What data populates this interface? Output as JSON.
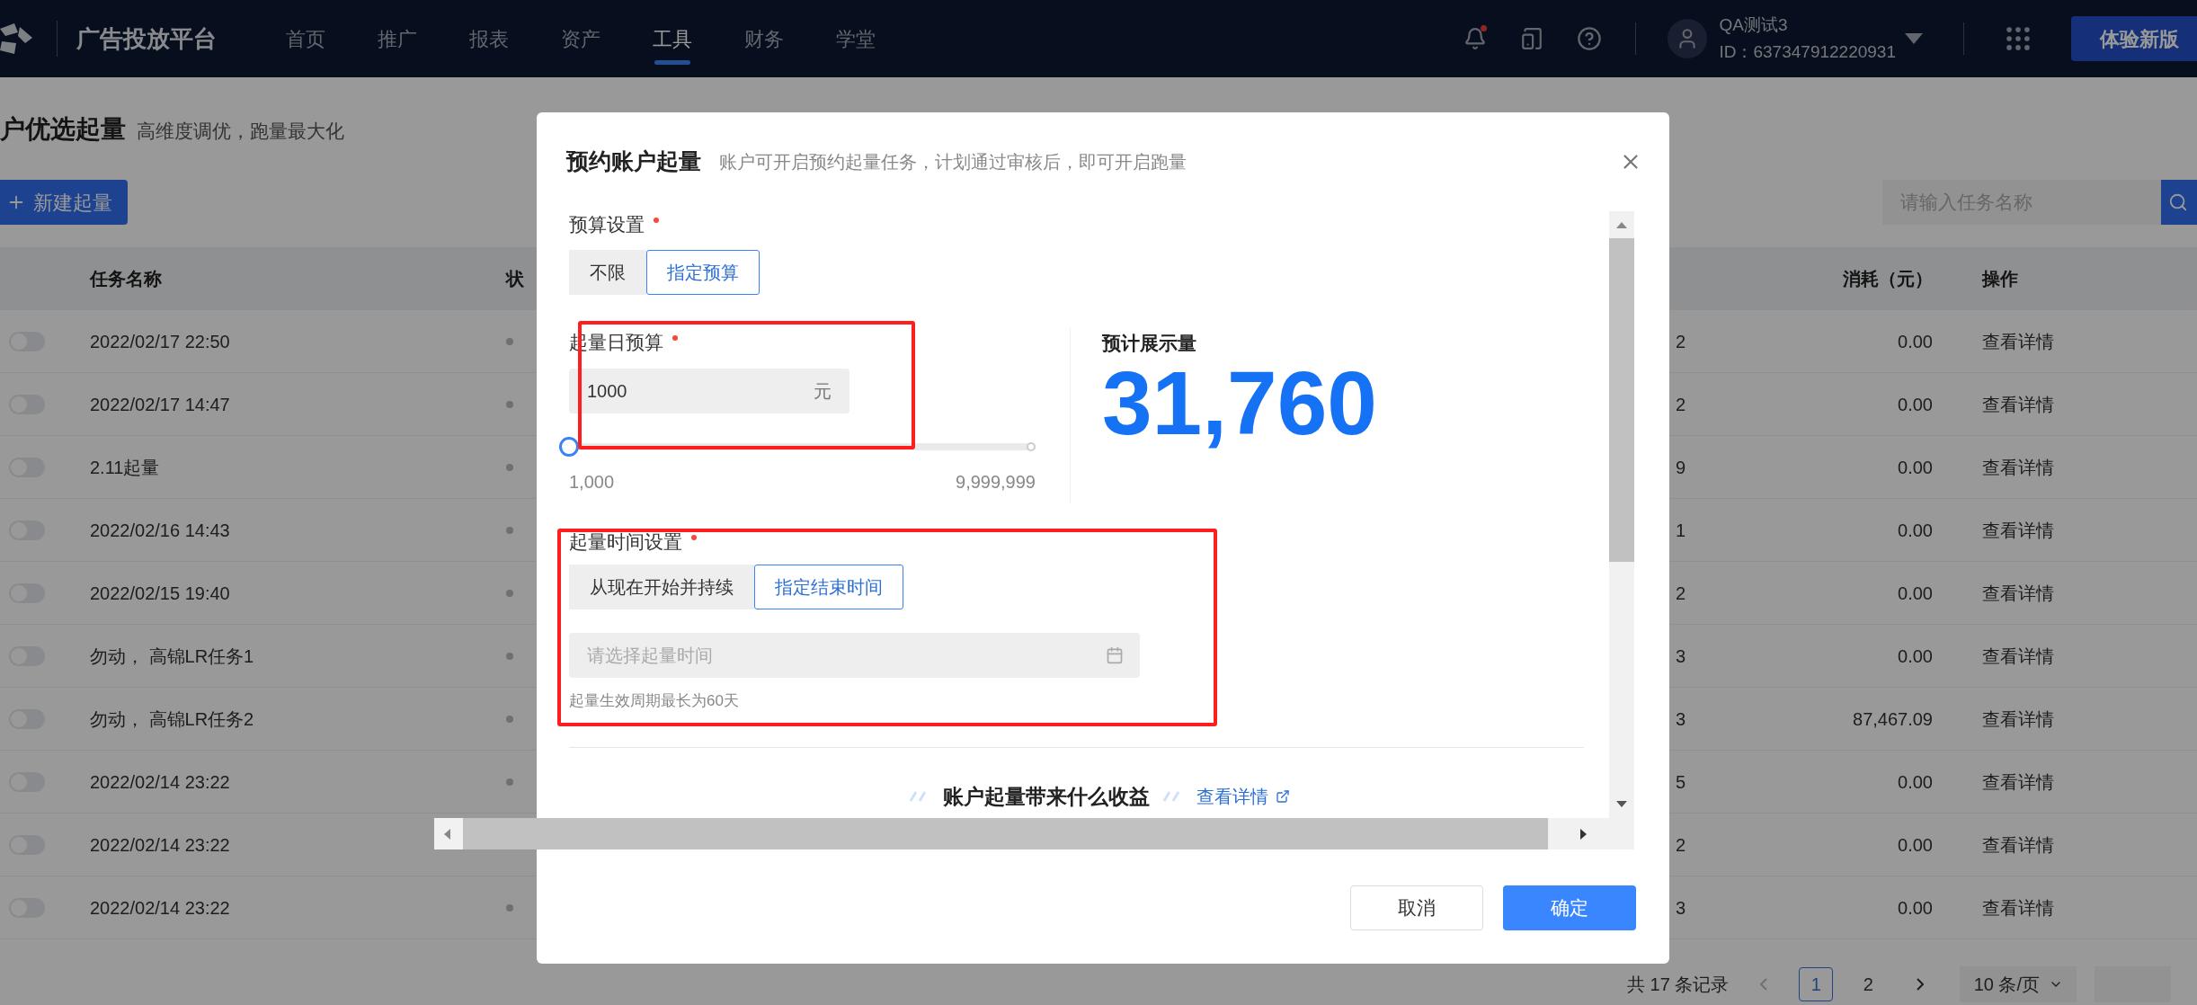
{
  "nav": {
    "brand": "广告投放平台",
    "menu": [
      {
        "label": "首页",
        "selected": false
      },
      {
        "label": "推广",
        "selected": false
      },
      {
        "label": "报表",
        "selected": false
      },
      {
        "label": "资产",
        "selected": false
      },
      {
        "label": "工具",
        "selected": true
      },
      {
        "label": "财务",
        "selected": false
      },
      {
        "label": "学堂",
        "selected": false
      }
    ],
    "unread": true,
    "user": {
      "name": "QA测试3",
      "id": "ID：637347912220931"
    },
    "cta": "体验新版"
  },
  "page": {
    "title": "户优选起量",
    "subtitle": "高维度调优，跑量最大化",
    "new_button": "新建起量",
    "search": {
      "placeholder": "请输入任务名称"
    }
  },
  "table": {
    "columns": {
      "name": "任务名称",
      "status": "状",
      "cost": "消耗（元）",
      "action": "操作"
    },
    "rows": [
      {
        "on": false,
        "name": "2022/02/17 22:50",
        "column_4": "2",
        "cost": "0.00",
        "action": "查看详情"
      },
      {
        "on": false,
        "name": "2022/02/17 14:47",
        "column_4": "2",
        "cost": "0.00",
        "action": "查看详情"
      },
      {
        "on": false,
        "name": "2.11起量",
        "column_4": "9",
        "cost": "0.00",
        "action": "查看详情"
      },
      {
        "on": false,
        "name": "2022/02/16 14:43",
        "column_4": "1",
        "cost": "0.00",
        "action": "查看详情"
      },
      {
        "on": false,
        "name": "2022/02/15 19:40",
        "column_4": "2",
        "cost": "0.00",
        "action": "查看详情"
      },
      {
        "on": false,
        "name": "勿动， 高锦LR任务1",
        "column_4": "3",
        "cost": "0.00",
        "action": "查看详情"
      },
      {
        "on": false,
        "name": "勿动， 高锦LR任务2",
        "column_4": "3",
        "cost": "87,467.09",
        "action": "查看详情"
      },
      {
        "on": false,
        "name": "2022/02/14 23:22",
        "column_4": "5",
        "cost": "0.00",
        "action": "查看详情"
      },
      {
        "on": false,
        "name": "2022/02/14 23:22",
        "status_dot": false,
        "column_4": "2",
        "cost": "0.00",
        "action": "查看详情"
      },
      {
        "on": false,
        "name": "2022/02/14 23:22",
        "column_4": "3",
        "cost": "0.00",
        "action": "查看详情"
      }
    ]
  },
  "pagination": {
    "total": "共 17 条记录",
    "pages": [
      {
        "label": "1",
        "selected": true
      },
      {
        "label": "2",
        "selected": false
      }
    ],
    "page_size": "10 条/页"
  },
  "modal": {
    "title": "预约账户起量",
    "subtitle": "账户可开启预约起量任务，计划通过审核后，即可开启跑量",
    "budget_mode": {
      "label": "预算设置",
      "required": true,
      "options": [
        {
          "label": "不限",
          "selected": false
        },
        {
          "label": "指定预算",
          "selected": true
        }
      ]
    },
    "daily_budget": {
      "label": "起量日预算",
      "required": true,
      "value": "1000",
      "unit": "元",
      "slider": {
        "level": 0,
        "min_label": "1,000",
        "max_label": "9,999,999"
      }
    },
    "estimate": {
      "label": "预计展示量",
      "value": "31,760"
    },
    "time_mode": {
      "label": "起量时间设置",
      "required": true,
      "options": [
        {
          "label": "从现在开始并持续",
          "selected": false
        },
        {
          "label": "指定结束时间",
          "selected": true
        }
      ],
      "date_field": {
        "placeholder": "请选择起量时间"
      },
      "hint": "起量生效周期最长为60天"
    },
    "benefits": {
      "title": "账户起量带来什么收益",
      "link": "查看详情"
    },
    "buttons": [
      {
        "label": "取消",
        "kind": "secondary"
      },
      {
        "label": "确定",
        "kind": "primary"
      }
    ]
  }
}
